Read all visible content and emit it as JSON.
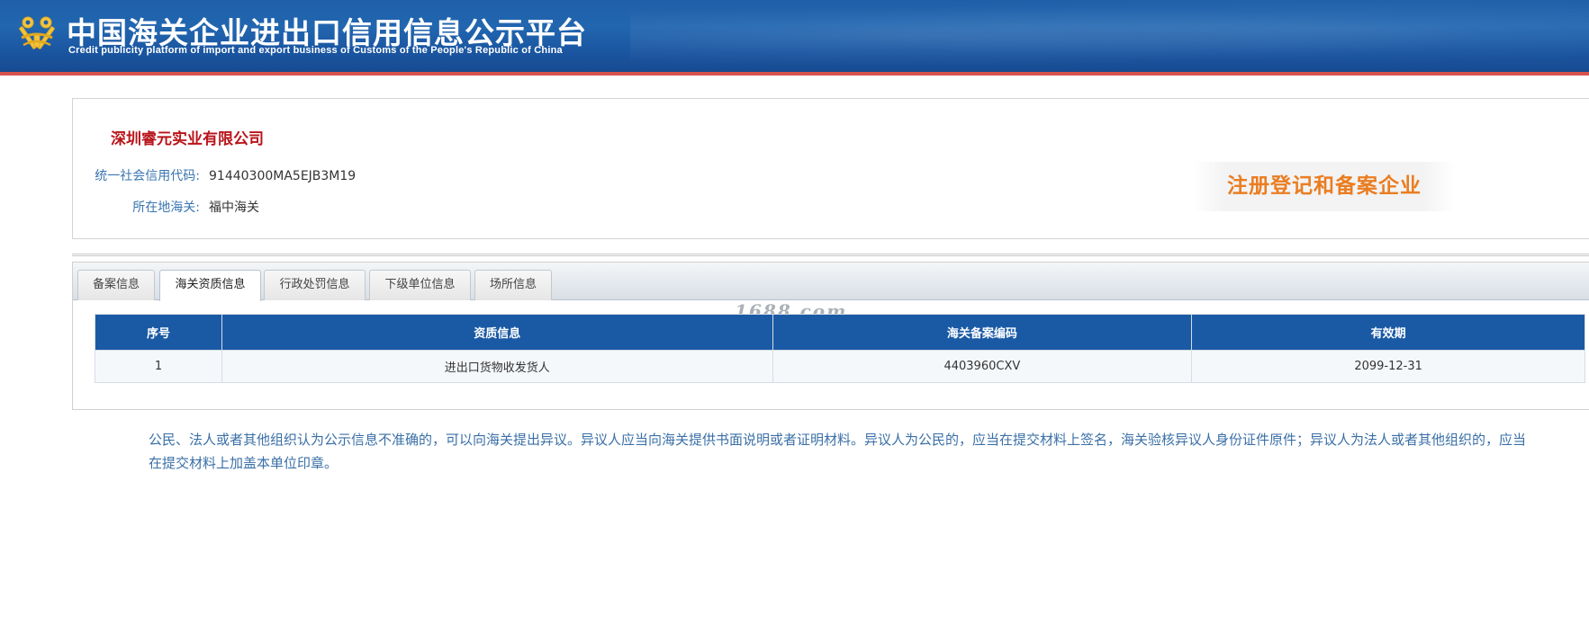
{
  "header": {
    "title_cn": "中国海关企业进出口信用信息公示平台",
    "title_en": "Credit publicity platform of import and export business of Customs of the People's Republic of China",
    "logo_icon": "customs-emblem-icon"
  },
  "company": {
    "name": "深圳睿元实业有限公司",
    "credit_code_label": "统一社会信用代码:",
    "credit_code_value": "91440300MA5EJB3M19",
    "customs_label": "所在地海关:",
    "customs_value": "福中海关",
    "badge": "注册登记和备案企业"
  },
  "tabs": [
    {
      "label": "备案信息",
      "active": false
    },
    {
      "label": "海关资质信息",
      "active": true
    },
    {
      "label": "行政处罚信息",
      "active": false
    },
    {
      "label": "下级单位信息",
      "active": false
    },
    {
      "label": "场所信息",
      "active": false
    }
  ],
  "watermark": "1688.com",
  "table": {
    "headers": [
      "序号",
      "资质信息",
      "海关备案编码",
      "有效期"
    ],
    "rows": [
      [
        "1",
        "进出口货物收发货人",
        "4403960CXV",
        "2099-12-31"
      ]
    ]
  },
  "notice": "公民、法人或者其他组织认为公示信息不准确的，可以向海关提出异议。异议人应当向海关提供书面说明或者证明材料。异议人为公民的，应当在提交材料上签名，海关验核异议人身份证件原件；异议人为法人或者其他组织的，应当在提交材料上加盖本单位印章。",
  "colors": {
    "header_blue": "#1f5fa9",
    "header_redline": "#d9534f",
    "company_red": "#b8141a",
    "label_blue": "#3a75b0",
    "badge_orange": "#ea7d22",
    "table_header_blue": "#1a5aa5"
  }
}
